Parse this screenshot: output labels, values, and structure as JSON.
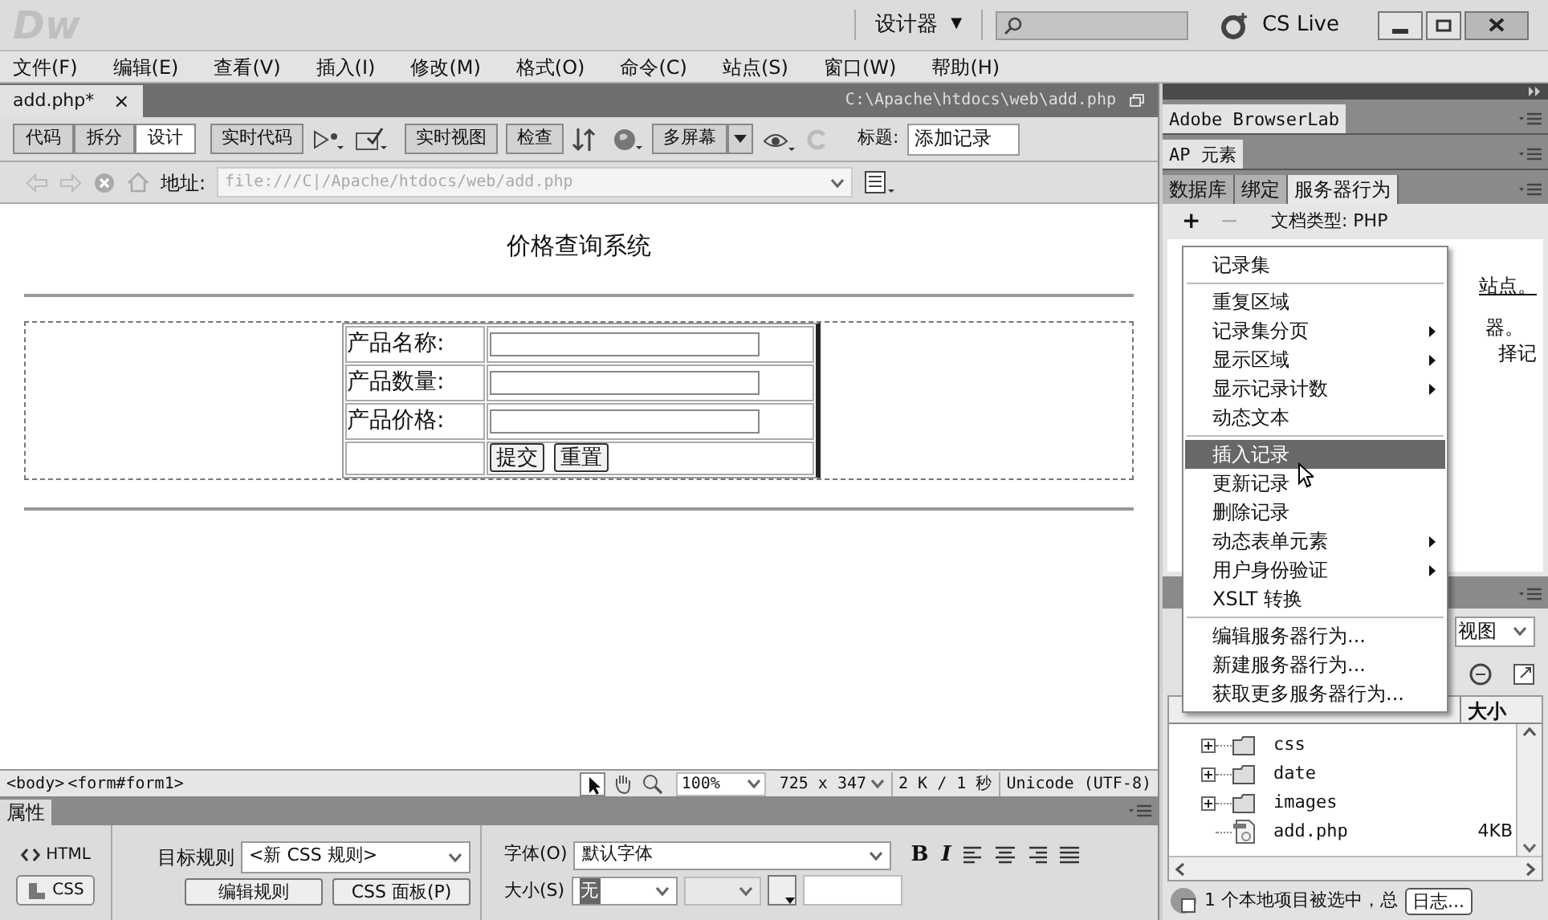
{
  "title_bar": {
    "logo": "Dw",
    "workspace": "设计器",
    "workspace_caret": "▼",
    "cs_live": "CS Live"
  },
  "menu_bar": [
    "文件(F)",
    "编辑(E)",
    "查看(V)",
    "插入(I)",
    "修改(M)",
    "格式(O)",
    "命令(C)",
    "站点(S)",
    "窗口(W)",
    "帮助(H)"
  ],
  "document": {
    "tab": {
      "label": "add.php*",
      "close": "×"
    },
    "path": "C:\\Apache\\htdocs\\web\\add.php"
  },
  "view_toolbar": {
    "view_modes": [
      {
        "label": "代码",
        "selected": false
      },
      {
        "label": "拆分",
        "selected": false
      },
      {
        "label": "设计",
        "selected": true
      }
    ],
    "live_code": "实时代码",
    "live_view": "实时视图",
    "inspect": "检查",
    "multiscreen": "多屏幕",
    "title_label": "标题:",
    "title_value": "添加记录"
  },
  "address_bar": {
    "label": "地址:",
    "value": "file:///C|/Apache/htdocs/web/add.php"
  },
  "page": {
    "heading": "价格查询系统",
    "form_rows": [
      {
        "label": "产品名称:"
      },
      {
        "label": "产品数量:"
      },
      {
        "label": "产品价格:"
      }
    ],
    "buttons": [
      "提交",
      "重置"
    ]
  },
  "status_bar": {
    "tags": [
      "<body>",
      "<form#form1>"
    ],
    "zoom": "100%",
    "size": "725 x 347",
    "download": "2 K / 1 秒",
    "encoding": "Unicode (UTF-8)"
  },
  "properties": {
    "tab": "属性",
    "modes": [
      {
        "label": "HTML",
        "selected": false
      },
      {
        "label": "CSS",
        "selected": true
      }
    ],
    "target_rule_label": "目标规则",
    "target_rule": "<新 CSS 规则>",
    "edit_rule": "编辑规则",
    "css_panel": "CSS 面板(P)",
    "font_label": "字体(O)",
    "font": "默认字体",
    "bold": "B",
    "italic": "I",
    "size_label": "大小(S)",
    "size": "无"
  },
  "right_panel": {
    "panels": [
      "Adobe BrowserLab",
      "AP 元素"
    ],
    "tabs": [
      {
        "label": "数据库",
        "selected": false
      },
      {
        "label": "绑定",
        "selected": false
      },
      {
        "label": "服务器行为",
        "selected": true
      }
    ],
    "add": "+",
    "remove": "−",
    "doc_type": "文档类型: PHP",
    "background_text": [
      "站点。",
      "器。",
      "择记"
    ],
    "menu": [
      {
        "kind": "item",
        "label": "记录集",
        "submenu": false,
        "selected": false
      },
      {
        "kind": "separator"
      },
      {
        "kind": "item",
        "label": "重复区域",
        "submenu": false,
        "selected": false
      },
      {
        "kind": "item",
        "label": "记录集分页",
        "submenu": true,
        "selected": false
      },
      {
        "kind": "item",
        "label": "显示区域",
        "submenu": true,
        "selected": false
      },
      {
        "kind": "item",
        "label": "显示记录计数",
        "submenu": true,
        "selected": false
      },
      {
        "kind": "item",
        "label": "动态文本",
        "submenu": false,
        "selected": false
      },
      {
        "kind": "separator"
      },
      {
        "kind": "item",
        "label": "插入记录",
        "submenu": false,
        "selected": true
      },
      {
        "kind": "item",
        "label": "更新记录",
        "submenu": false,
        "selected": false
      },
      {
        "kind": "item",
        "label": "删除记录",
        "submenu": false,
        "selected": false
      },
      {
        "kind": "item",
        "label": "动态表单元素",
        "submenu": true,
        "selected": false
      },
      {
        "kind": "item",
        "label": "用户身份验证",
        "submenu": true,
        "selected": false
      },
      {
        "kind": "item",
        "label": "XSLT 转换",
        "submenu": false,
        "selected": false
      },
      {
        "kind": "separator"
      },
      {
        "kind": "item",
        "label": "编辑服务器行为...",
        "submenu": false,
        "selected": false
      },
      {
        "kind": "item",
        "label": "新建服务器行为...",
        "submenu": false,
        "selected": false
      },
      {
        "kind": "item",
        "label": "获取更多服务器行为...",
        "submenu": false,
        "selected": false
      }
    ],
    "files": {
      "view": "视图",
      "size_header": "大小",
      "tree": [
        {
          "name": "css",
          "kind": "folder"
        },
        {
          "name": "date",
          "kind": "folder"
        },
        {
          "name": "images",
          "kind": "folder"
        },
        {
          "name": "add.php",
          "kind": "file",
          "size": "4KB"
        }
      ],
      "status": "1 个本地项目被选中，总",
      "log_button": "日志..."
    }
  }
}
